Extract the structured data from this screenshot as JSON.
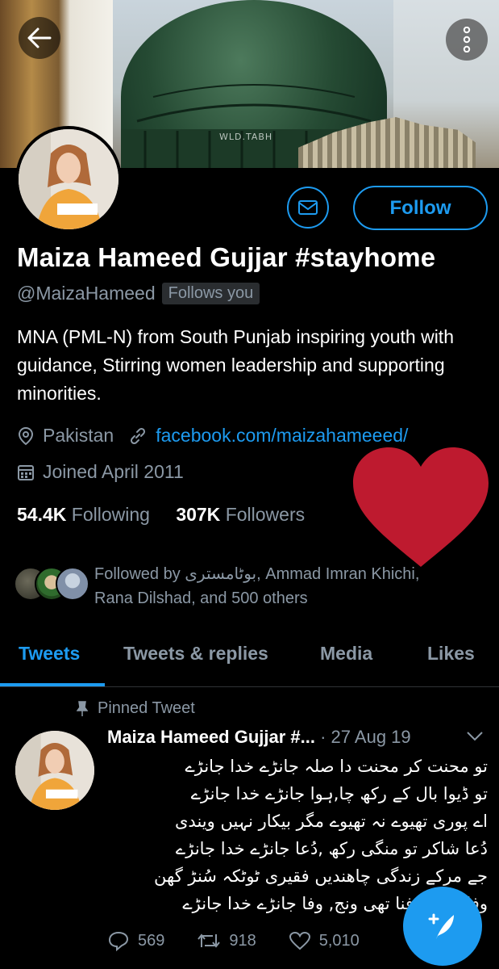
{
  "banner": {
    "dome_text": "WLD.TABH"
  },
  "header": {
    "back_icon": "arrow-left-icon",
    "more_icon": "more-vertical-icon"
  },
  "profile": {
    "name": "Maiza Hameed Gujjar #stayhome",
    "handle": "@MaizaHameed",
    "follows_you": "Follows you",
    "follow_label": "Follow",
    "message_icon": "envelope-icon",
    "bio": "MNA (PML-N) from South Punjab inspiring youth with guidance, Stirring women leadership and supporting minorities.",
    "location": "Pakistan",
    "website": "facebook.com/maizahameeed/",
    "joined": "Joined April 2011",
    "following_count": "54.4K",
    "following_label": "Following",
    "followers_count": "307K",
    "followers_label": "Followers",
    "followed_by_line1": "Followed by بوٹامستری, Ammad Imran Khichi,",
    "followed_by_line2": "Rana Dilshad, and 500 others"
  },
  "tabs": [
    {
      "label": "Tweets",
      "active": true
    },
    {
      "label": "Tweets & replies",
      "active": false
    },
    {
      "label": "Media",
      "active": false
    },
    {
      "label": "Likes",
      "active": false
    }
  ],
  "tweet": {
    "pinned_label": "Pinned Tweet",
    "author": "Maiza Hameed Gujjar #...",
    "date": "· 27 Aug 19",
    "lines": [
      "تو محنت کر محنت دا صلہ جانڑے خدا جانڑے",
      "تو ڈیوا بال کے رکھ چا,ہوا جانڑے خدا جانڑے",
      "اے پوری تھیوے نہ تھیوے مگر بیکار نہیں ویندی",
      "دُعا شاکر تو منگی رکھ ,دُعا جانڑے خدا جانڑے",
      "جے مرکے زندگی چاھندیں فقیری ٹوٹکہ سُنڑ گھن",
      "وفا دے وچ فنا تھی ونج, وفا جانڑے خدا جانڑے"
    ],
    "replies": "569",
    "retweets": "918",
    "likes": "5,010"
  },
  "colors": {
    "accent": "#1d9bf0",
    "heart": "#be1a2f"
  }
}
